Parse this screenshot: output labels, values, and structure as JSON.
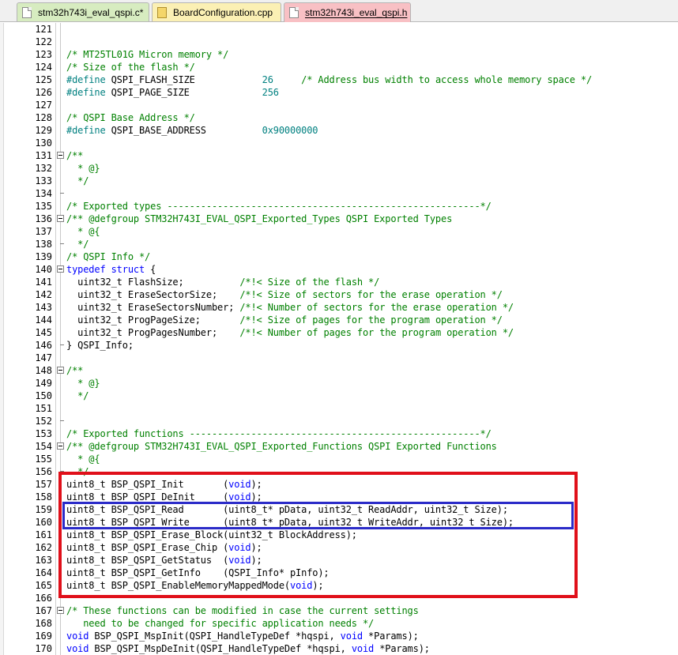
{
  "tabs": [
    {
      "label": "stm32h743i_eval_qspi.c*",
      "icon": "c-file-icon",
      "active": false
    },
    {
      "label": "BoardConfiguration.cpp",
      "icon": "cpp-file-icon",
      "active": false
    },
    {
      "label": "stm32h743i_eval_qspi.h",
      "icon": "h-file-icon",
      "active": true
    }
  ],
  "colors": {
    "comment": "#008000",
    "preprocessor": "#008080",
    "keyword": "#0000ff",
    "highlight_red": "#e0101a",
    "highlight_blue": "#2b2bc8"
  },
  "lines": [
    {
      "n": "121",
      "fold": "",
      "segs": []
    },
    {
      "n": "122",
      "fold": "",
      "segs": []
    },
    {
      "n": "123",
      "fold": "",
      "segs": [
        {
          "c": "com",
          "t": "/* MT25TL01G Micron memory */"
        }
      ]
    },
    {
      "n": "124",
      "fold": "",
      "segs": [
        {
          "c": "com",
          "t": "/* Size of the flash */"
        }
      ]
    },
    {
      "n": "125",
      "fold": "",
      "segs": [
        {
          "c": "pre",
          "t": "#define "
        },
        {
          "c": "plain",
          "t": "QSPI_FLASH_SIZE            "
        },
        {
          "c": "num",
          "t": "26"
        },
        {
          "c": "plain",
          "t": "     "
        },
        {
          "c": "com",
          "t": "/* Address bus width to access whole memory space */"
        }
      ]
    },
    {
      "n": "126",
      "fold": "",
      "segs": [
        {
          "c": "pre",
          "t": "#define "
        },
        {
          "c": "plain",
          "t": "QSPI_PAGE_SIZE             "
        },
        {
          "c": "num",
          "t": "256"
        }
      ]
    },
    {
      "n": "127",
      "fold": "",
      "segs": []
    },
    {
      "n": "128",
      "fold": "",
      "segs": [
        {
          "c": "com",
          "t": "/* QSPI Base Address */"
        }
      ]
    },
    {
      "n": "129",
      "fold": "",
      "segs": [
        {
          "c": "pre",
          "t": "#define "
        },
        {
          "c": "plain",
          "t": "QSPI_BASE_ADDRESS          "
        },
        {
          "c": "num",
          "t": "0x90000000"
        }
      ]
    },
    {
      "n": "130",
      "fold": "",
      "segs": []
    },
    {
      "n": "131",
      "fold": "start",
      "segs": [
        {
          "c": "com",
          "t": "/**"
        }
      ]
    },
    {
      "n": "132",
      "fold": "",
      "segs": [
        {
          "c": "com",
          "t": "  * @}"
        }
      ]
    },
    {
      "n": "133",
      "fold": "",
      "segs": [
        {
          "c": "com",
          "t": "  */"
        }
      ]
    },
    {
      "n": "134",
      "fold": "end",
      "segs": []
    },
    {
      "n": "135",
      "fold": "",
      "segs": [
        {
          "c": "com",
          "t": "/* Exported types --------------------------------------------------------*/"
        }
      ]
    },
    {
      "n": "136",
      "fold": "start",
      "segs": [
        {
          "c": "com",
          "t": "/** @defgroup STM32H743I_EVAL_QSPI_Exported_Types QSPI Exported Types"
        }
      ]
    },
    {
      "n": "137",
      "fold": "",
      "segs": [
        {
          "c": "com",
          "t": "  * @{"
        }
      ]
    },
    {
      "n": "138",
      "fold": "end",
      "segs": [
        {
          "c": "com",
          "t": "  */"
        }
      ]
    },
    {
      "n": "139",
      "fold": "",
      "segs": [
        {
          "c": "com",
          "t": "/* QSPI Info */"
        }
      ]
    },
    {
      "n": "140",
      "fold": "start",
      "segs": [
        {
          "c": "kw",
          "t": "typedef struct "
        },
        {
          "c": "plain",
          "t": "{"
        }
      ]
    },
    {
      "n": "141",
      "fold": "",
      "segs": [
        {
          "c": "plain",
          "t": "  uint32_t FlashSize;          "
        },
        {
          "c": "com",
          "t": "/*!< Size of the flash */"
        }
      ]
    },
    {
      "n": "142",
      "fold": "",
      "segs": [
        {
          "c": "plain",
          "t": "  uint32_t EraseSectorSize;    "
        },
        {
          "c": "com",
          "t": "/*!< Size of sectors for the erase operation */"
        }
      ]
    },
    {
      "n": "143",
      "fold": "",
      "segs": [
        {
          "c": "plain",
          "t": "  uint32_t EraseSectorsNumber; "
        },
        {
          "c": "com",
          "t": "/*!< Number of sectors for the erase operation */"
        }
      ]
    },
    {
      "n": "144",
      "fold": "",
      "segs": [
        {
          "c": "plain",
          "t": "  uint32_t ProgPageSize;       "
        },
        {
          "c": "com",
          "t": "/*!< Size of pages for the program operation */"
        }
      ]
    },
    {
      "n": "145",
      "fold": "",
      "segs": [
        {
          "c": "plain",
          "t": "  uint32_t ProgPagesNumber;    "
        },
        {
          "c": "com",
          "t": "/*!< Number of pages for the program operation */"
        }
      ]
    },
    {
      "n": "146",
      "fold": "end",
      "segs": [
        {
          "c": "plain",
          "t": "} QSPI_Info;"
        }
      ]
    },
    {
      "n": "147",
      "fold": "",
      "segs": []
    },
    {
      "n": "148",
      "fold": "start",
      "segs": [
        {
          "c": "com",
          "t": "/**"
        }
      ]
    },
    {
      "n": "149",
      "fold": "",
      "segs": [
        {
          "c": "com",
          "t": "  * @}"
        }
      ]
    },
    {
      "n": "150",
      "fold": "",
      "segs": [
        {
          "c": "com",
          "t": "  */"
        }
      ]
    },
    {
      "n": "151",
      "fold": "",
      "segs": []
    },
    {
      "n": "152",
      "fold": "end",
      "segs": []
    },
    {
      "n": "153",
      "fold": "",
      "segs": [
        {
          "c": "com",
          "t": "/* Exported functions ----------------------------------------------------*/"
        }
      ]
    },
    {
      "n": "154",
      "fold": "start",
      "segs": [
        {
          "c": "com",
          "t": "/** @defgroup STM32H743I_EVAL_QSPI_Exported_Functions QSPI Exported Functions"
        }
      ]
    },
    {
      "n": "155",
      "fold": "",
      "segs": [
        {
          "c": "com",
          "t": "  * @{"
        }
      ]
    },
    {
      "n": "156",
      "fold": "end",
      "segs": [
        {
          "c": "com",
          "t": "  */"
        }
      ]
    },
    {
      "n": "157",
      "fold": "",
      "segs": [
        {
          "c": "plain",
          "t": "uint8_t BSP_QSPI_Init       ("
        },
        {
          "c": "kw",
          "t": "void"
        },
        {
          "c": "plain",
          "t": ");"
        }
      ]
    },
    {
      "n": "158",
      "fold": "",
      "segs": [
        {
          "c": "plain",
          "t": "uint8_t BSP_QSPI_DeInit     ("
        },
        {
          "c": "kw",
          "t": "void"
        },
        {
          "c": "plain",
          "t": ");"
        }
      ]
    },
    {
      "n": "159",
      "fold": "",
      "segs": [
        {
          "c": "plain",
          "t": "uint8_t BSP_QSPI_Read       (uint8_t* pData, uint32_t ReadAddr, uint32_t Size);"
        }
      ]
    },
    {
      "n": "160",
      "fold": "",
      "segs": [
        {
          "c": "plain",
          "t": "uint8_t BSP_QSPI_Write      (uint8_t* pData, uint32_t WriteAddr, uint32_t Size);"
        }
      ]
    },
    {
      "n": "161",
      "fold": "",
      "segs": [
        {
          "c": "plain",
          "t": "uint8_t BSP_QSPI_Erase_Block(uint32_t BlockAddress);"
        }
      ]
    },
    {
      "n": "162",
      "fold": "",
      "segs": [
        {
          "c": "plain",
          "t": "uint8_t BSP_QSPI_Erase_Chip ("
        },
        {
          "c": "kw",
          "t": "void"
        },
        {
          "c": "plain",
          "t": ");"
        }
      ]
    },
    {
      "n": "163",
      "fold": "",
      "segs": [
        {
          "c": "plain",
          "t": "uint8_t BSP_QSPI_GetStatus  ("
        },
        {
          "c": "kw",
          "t": "void"
        },
        {
          "c": "plain",
          "t": ");"
        }
      ]
    },
    {
      "n": "164",
      "fold": "",
      "segs": [
        {
          "c": "plain",
          "t": "uint8_t BSP_QSPI_GetInfo    (QSPI_Info* pInfo);"
        }
      ]
    },
    {
      "n": "165",
      "fold": "",
      "segs": [
        {
          "c": "plain",
          "t": "uint8_t BSP_QSPI_EnableMemoryMappedMode("
        },
        {
          "c": "kw",
          "t": "void"
        },
        {
          "c": "plain",
          "t": ");"
        }
      ]
    },
    {
      "n": "166",
      "fold": "",
      "segs": []
    },
    {
      "n": "167",
      "fold": "start",
      "segs": [
        {
          "c": "com",
          "t": "/* These functions can be modified in case the current settings"
        }
      ]
    },
    {
      "n": "168",
      "fold": "",
      "segs": [
        {
          "c": "com",
          "t": "   need to be changed for specific application needs */"
        }
      ]
    },
    {
      "n": "169",
      "fold": "",
      "segs": [
        {
          "c": "kw",
          "t": "void "
        },
        {
          "c": "plain",
          "t": "BSP_QSPI_MspInit(QSPI_HandleTypeDef *hqspi, "
        },
        {
          "c": "kw",
          "t": "void "
        },
        {
          "c": "plain",
          "t": "*Params);"
        }
      ]
    },
    {
      "n": "170",
      "fold": "",
      "segs": [
        {
          "c": "kw",
          "t": "void "
        },
        {
          "c": "plain",
          "t": "BSP_QSPI_MspDeInit(QSPI_HandleTypeDef *hqspi, "
        },
        {
          "c": "kw",
          "t": "void "
        },
        {
          "c": "plain",
          "t": "*Params);"
        }
      ]
    }
  ]
}
